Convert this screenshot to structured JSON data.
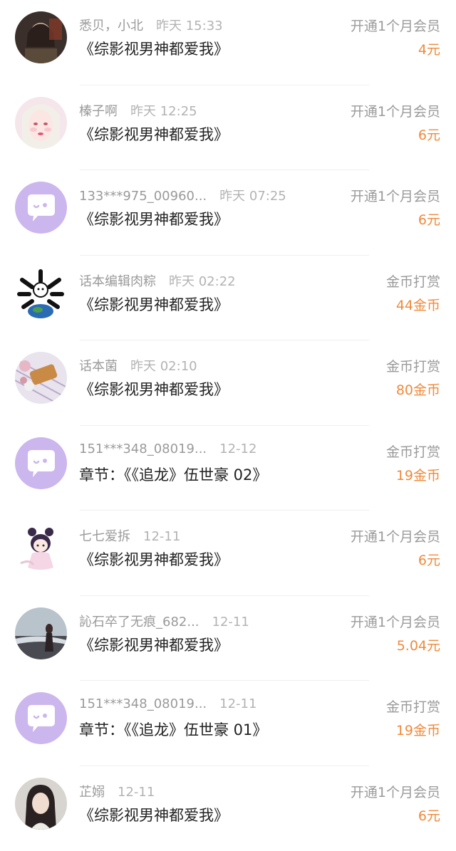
{
  "rows": [
    {
      "name": "悉贝，小北",
      "time": "昨天 15:33",
      "title": "《综影视男神都爱我》",
      "kind": "开通1个月会员",
      "amount": "4元",
      "avatar": "photo-dark"
    },
    {
      "name": "榛子啊",
      "time": "昨天 12:25",
      "title": "《综影视男神都爱我》",
      "kind": "开通1个月会员",
      "amount": "6元",
      "avatar": "anime-girl"
    },
    {
      "name": "133***975_00960...",
      "time": "昨天 07:25",
      "title": "《综影视男神都爱我》",
      "kind": "开通1个月会员",
      "amount": "6元",
      "avatar": "default-chat-icon"
    },
    {
      "name": "话本编辑肉粽",
      "time": "昨天 02:22",
      "title": "《综影视男神都爱我》",
      "kind": "金币打赏",
      "amount": "44金币",
      "avatar": "globe-logo"
    },
    {
      "name": "话本菌",
      "time": "昨天 02:10",
      "title": "《综影视男神都爱我》",
      "kind": "金币打赏",
      "amount": "80金币",
      "avatar": "food-photo"
    },
    {
      "name": "151***348_08019...",
      "time": "12-12",
      "title": "章节：《《追龙》伍世豪 02》",
      "kind": "金币打赏",
      "amount": "19金币",
      "avatar": "default-chat-icon"
    },
    {
      "name": "七七爱拆",
      "time": "12-11",
      "title": "《综影视男神都爱我》",
      "kind": "开通1个月会员",
      "amount": "6元",
      "avatar": "chibi-girl"
    },
    {
      "name": "訫石卒了无痕_682...",
      "time": "12-11",
      "title": "《综影视男神都爱我》",
      "kind": "开通1个月会员",
      "amount": "5.04元",
      "avatar": "beach-photo"
    },
    {
      "name": "151***348_08019...",
      "time": "12-11",
      "title": "章节：《《追龙》伍世豪 01》",
      "kind": "金币打赏",
      "amount": "19金币",
      "avatar": "default-chat-icon"
    },
    {
      "name": "芷嫋",
      "time": "12-11",
      "title": "《综影视男神都爱我》",
      "kind": "开通1个月会员",
      "amount": "6元",
      "avatar": "portrait-photo"
    }
  ],
  "colors": {
    "accent": "#f08a3c",
    "meta": "#9a9a9a",
    "title": "#222222",
    "default_avatar": "#ccb6ee"
  }
}
